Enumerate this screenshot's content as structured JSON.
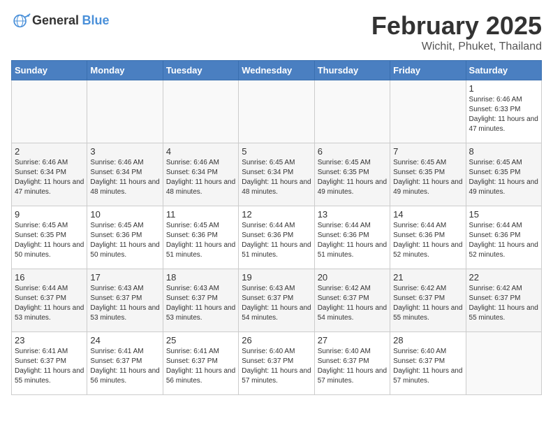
{
  "header": {
    "logo_general": "General",
    "logo_blue": "Blue",
    "title": "February 2025",
    "subtitle": "Wichit, Phuket, Thailand"
  },
  "days_of_week": [
    "Sunday",
    "Monday",
    "Tuesday",
    "Wednesday",
    "Thursday",
    "Friday",
    "Saturday"
  ],
  "weeks": [
    [
      {
        "day": "",
        "info": ""
      },
      {
        "day": "",
        "info": ""
      },
      {
        "day": "",
        "info": ""
      },
      {
        "day": "",
        "info": ""
      },
      {
        "day": "",
        "info": ""
      },
      {
        "day": "",
        "info": ""
      },
      {
        "day": "1",
        "info": "Sunrise: 6:46 AM\nSunset: 6:33 PM\nDaylight: 11 hours and 47 minutes."
      }
    ],
    [
      {
        "day": "2",
        "info": "Sunrise: 6:46 AM\nSunset: 6:34 PM\nDaylight: 11 hours and 47 minutes."
      },
      {
        "day": "3",
        "info": "Sunrise: 6:46 AM\nSunset: 6:34 PM\nDaylight: 11 hours and 48 minutes."
      },
      {
        "day": "4",
        "info": "Sunrise: 6:46 AM\nSunset: 6:34 PM\nDaylight: 11 hours and 48 minutes."
      },
      {
        "day": "5",
        "info": "Sunrise: 6:45 AM\nSunset: 6:34 PM\nDaylight: 11 hours and 48 minutes."
      },
      {
        "day": "6",
        "info": "Sunrise: 6:45 AM\nSunset: 6:35 PM\nDaylight: 11 hours and 49 minutes."
      },
      {
        "day": "7",
        "info": "Sunrise: 6:45 AM\nSunset: 6:35 PM\nDaylight: 11 hours and 49 minutes."
      },
      {
        "day": "8",
        "info": "Sunrise: 6:45 AM\nSunset: 6:35 PM\nDaylight: 11 hours and 49 minutes."
      }
    ],
    [
      {
        "day": "9",
        "info": "Sunrise: 6:45 AM\nSunset: 6:35 PM\nDaylight: 11 hours and 50 minutes."
      },
      {
        "day": "10",
        "info": "Sunrise: 6:45 AM\nSunset: 6:36 PM\nDaylight: 11 hours and 50 minutes."
      },
      {
        "day": "11",
        "info": "Sunrise: 6:45 AM\nSunset: 6:36 PM\nDaylight: 11 hours and 51 minutes."
      },
      {
        "day": "12",
        "info": "Sunrise: 6:44 AM\nSunset: 6:36 PM\nDaylight: 11 hours and 51 minutes."
      },
      {
        "day": "13",
        "info": "Sunrise: 6:44 AM\nSunset: 6:36 PM\nDaylight: 11 hours and 51 minutes."
      },
      {
        "day": "14",
        "info": "Sunrise: 6:44 AM\nSunset: 6:36 PM\nDaylight: 11 hours and 52 minutes."
      },
      {
        "day": "15",
        "info": "Sunrise: 6:44 AM\nSunset: 6:36 PM\nDaylight: 11 hours and 52 minutes."
      }
    ],
    [
      {
        "day": "16",
        "info": "Sunrise: 6:44 AM\nSunset: 6:37 PM\nDaylight: 11 hours and 53 minutes."
      },
      {
        "day": "17",
        "info": "Sunrise: 6:43 AM\nSunset: 6:37 PM\nDaylight: 11 hours and 53 minutes."
      },
      {
        "day": "18",
        "info": "Sunrise: 6:43 AM\nSunset: 6:37 PM\nDaylight: 11 hours and 53 minutes."
      },
      {
        "day": "19",
        "info": "Sunrise: 6:43 AM\nSunset: 6:37 PM\nDaylight: 11 hours and 54 minutes."
      },
      {
        "day": "20",
        "info": "Sunrise: 6:42 AM\nSunset: 6:37 PM\nDaylight: 11 hours and 54 minutes."
      },
      {
        "day": "21",
        "info": "Sunrise: 6:42 AM\nSunset: 6:37 PM\nDaylight: 11 hours and 55 minutes."
      },
      {
        "day": "22",
        "info": "Sunrise: 6:42 AM\nSunset: 6:37 PM\nDaylight: 11 hours and 55 minutes."
      }
    ],
    [
      {
        "day": "23",
        "info": "Sunrise: 6:41 AM\nSunset: 6:37 PM\nDaylight: 11 hours and 55 minutes."
      },
      {
        "day": "24",
        "info": "Sunrise: 6:41 AM\nSunset: 6:37 PM\nDaylight: 11 hours and 56 minutes."
      },
      {
        "day": "25",
        "info": "Sunrise: 6:41 AM\nSunset: 6:37 PM\nDaylight: 11 hours and 56 minutes."
      },
      {
        "day": "26",
        "info": "Sunrise: 6:40 AM\nSunset: 6:37 PM\nDaylight: 11 hours and 57 minutes."
      },
      {
        "day": "27",
        "info": "Sunrise: 6:40 AM\nSunset: 6:37 PM\nDaylight: 11 hours and 57 minutes."
      },
      {
        "day": "28",
        "info": "Sunrise: 6:40 AM\nSunset: 6:37 PM\nDaylight: 11 hours and 57 minutes."
      },
      {
        "day": "",
        "info": ""
      }
    ]
  ]
}
